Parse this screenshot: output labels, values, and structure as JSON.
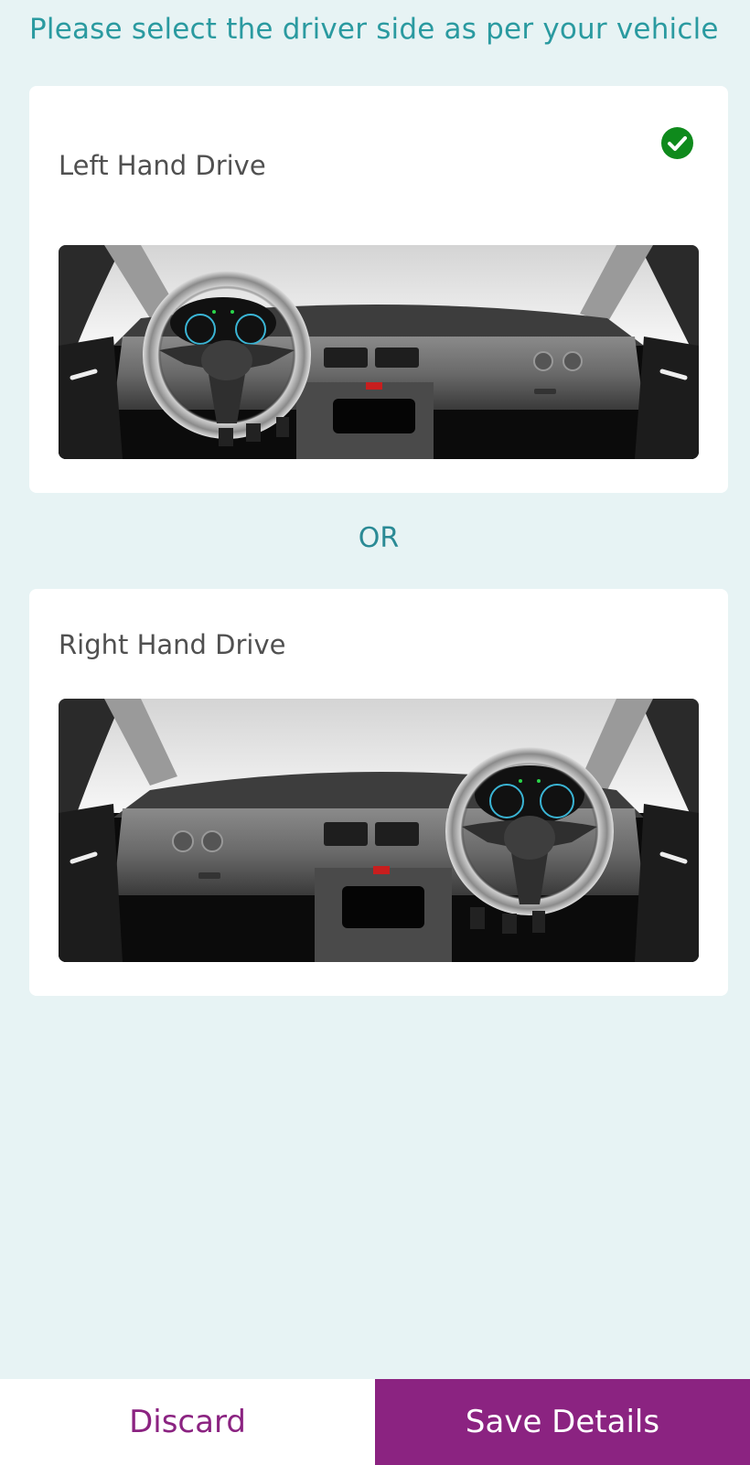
{
  "instruction": "Please select the driver side as per your vehicle",
  "options": [
    {
      "label": "Left Hand Drive",
      "selected": true,
      "image_icon": "car-dashboard-left-steering"
    },
    {
      "label": "Right Hand Drive",
      "selected": false,
      "image_icon": "car-dashboard-right-steering"
    }
  ],
  "separator": "OR",
  "footer": {
    "discard_label": "Discard",
    "save_label": "Save Details"
  },
  "colors": {
    "background": "#e7f3f4",
    "accent_teal": "#2a9aa0",
    "brand_purple": "#8b2381",
    "check_green": "#0f8a1c"
  }
}
